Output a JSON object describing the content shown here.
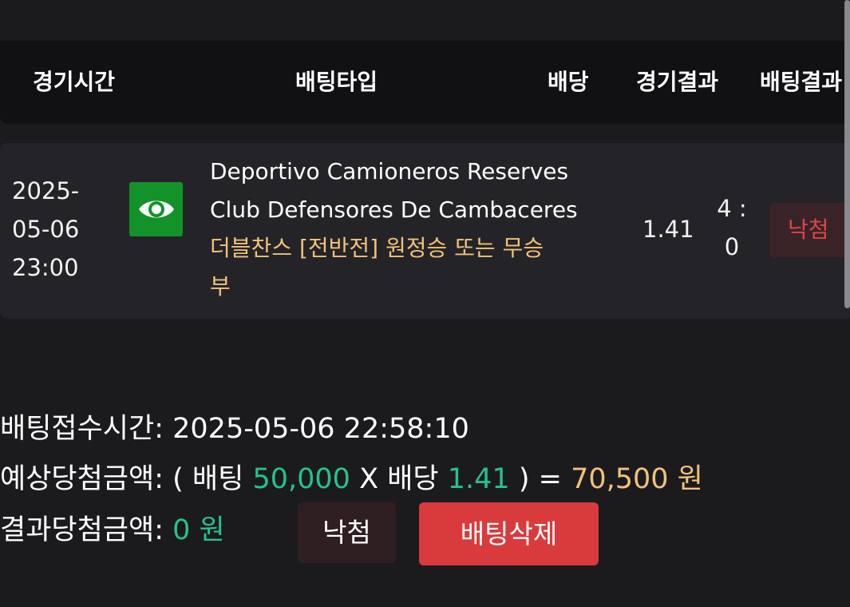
{
  "header": {
    "columns": [
      "경기시간",
      "배팅타입",
      "배당",
      "경기결과",
      "배팅결과"
    ]
  },
  "bet_row": {
    "time_lines": [
      "2025-",
      "05-06",
      "23:00"
    ],
    "icon": "eye-icon",
    "home_team": "Deportivo Camioneros Reserves",
    "away_team": "Club Defensores De Cambaceres",
    "bet_type": "더블찬스 [전반전] 원정승 또는 무승부",
    "odds": "1.41",
    "score_lines": [
      "4 :",
      "0"
    ],
    "result": "낙첨"
  },
  "summary": {
    "received_label": "배팅접수시간:",
    "received_time": "2025-05-06 22:58:10",
    "expected_label": "예상당첨금액:",
    "expected_open": "( 배팅",
    "bet_amount": "50,000",
    "times_text": "X 배당",
    "odds": "1.41",
    "close_eq": ") =",
    "expected_amount": "70,500 원",
    "result_label": "결과당첨금액:",
    "result_amount": "0 원"
  },
  "buttons": {
    "lose_label": "낙첨",
    "delete_label": "배팅삭제"
  },
  "colors": {
    "accent_green": "#27c28b",
    "accent_gold": "#f1c27a",
    "lose_red": "#d8474a",
    "delete_red": "#d93a3c",
    "icon_green": "#14922a"
  }
}
